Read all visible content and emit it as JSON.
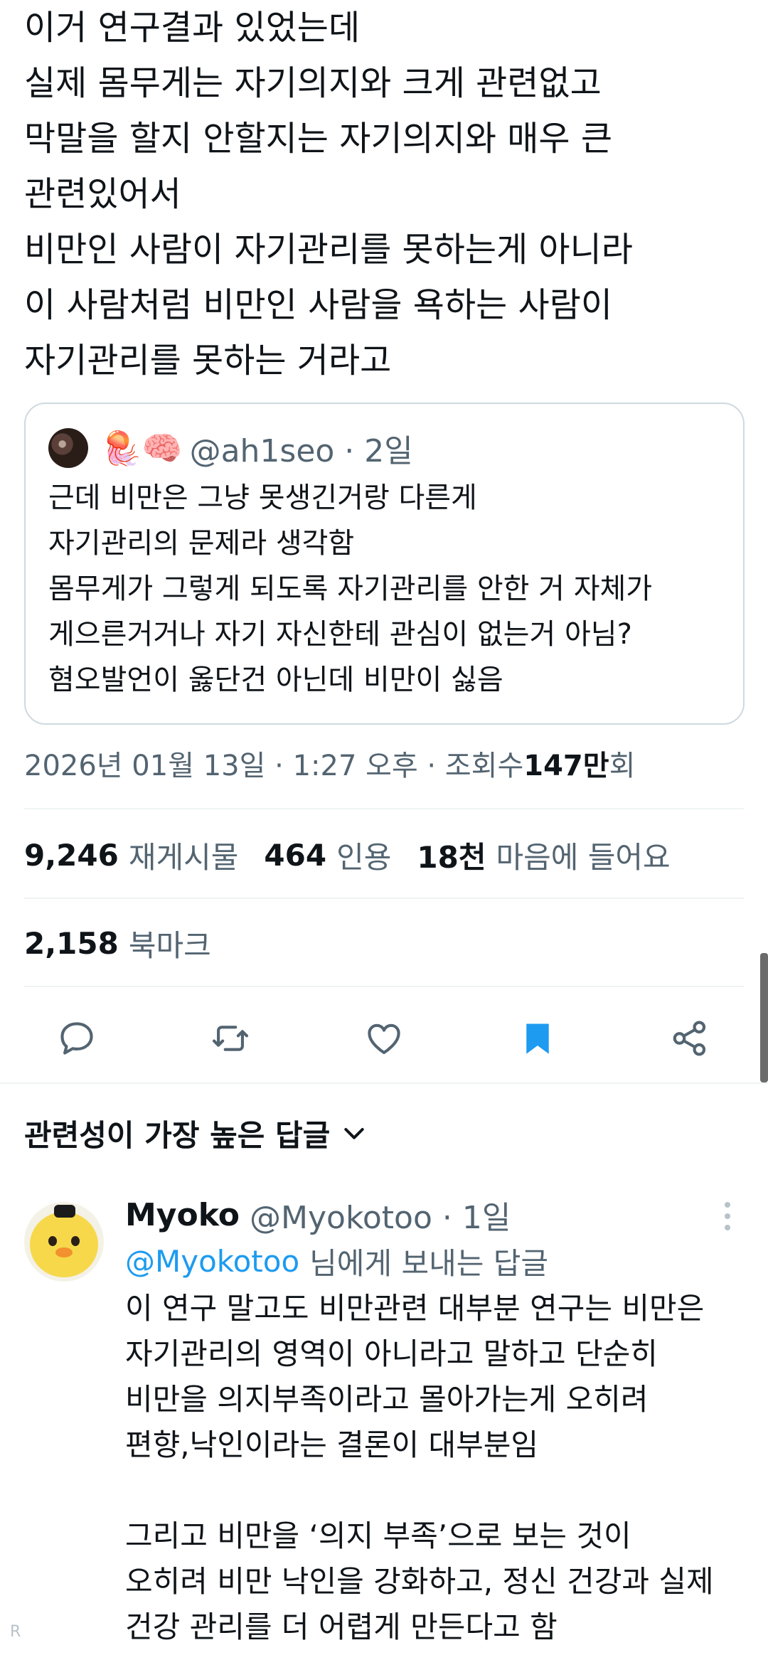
{
  "tweet": {
    "lines": [
      "이거 연구결과 있었는데",
      "실제 몸무게는 자기의지와 크게 관련없고",
      "막말을 할지 안할지는 자기의지와 매우 큰",
      "관련있어서",
      "비만인 사람이 자기관리를 못하는게 아니라",
      "이 사람처럼 비만인 사람을 욕하는 사람이",
      "자기관리를 못하는 거라고"
    ]
  },
  "quote": {
    "emojis": "🪼🧠",
    "handle": "@ah1seo · 2일",
    "lines": [
      "근데 비만은 그냥 못생긴거랑 다른게",
      "자기관리의 문제라 생각함",
      "몸무게가 그렇게 되도록 자기관리를 안한 거 자체가",
      "게으른거거나 자기 자신한테 관심이 없는거 아님?",
      "혐오발언이 옳단건 아닌데 비만이 싫음"
    ]
  },
  "meta": {
    "datetime": "2026년 01월 13일 · 1:27 오후 · 조회수 ",
    "views_num": "147만",
    "views_unit": "회"
  },
  "stats": {
    "retweets_num": "9,246",
    "retweets_label": "재게시물",
    "quotes_num": "464",
    "quotes_label": "인용",
    "likes_num": "18천",
    "likes_label": "마음에 들어요",
    "bookmarks_num": "2,158",
    "bookmarks_label": "북마크"
  },
  "colors": {
    "accent": "#1d9bf0",
    "icon": "#536471",
    "text": "#0f1419"
  },
  "replies_sort": {
    "label": "관련성이 가장 높은 답글"
  },
  "reply": {
    "name": "Myoko",
    "handle": "@Myokotoo · 1일",
    "mention": "@Myokotoo",
    "reply_to_suffix": "님에게 보내는 답글",
    "lines": [
      "이 연구 말고도 비만관련 대부분 연구는 비만은",
      "자기관리의 영역이 아니라고 말하고 단순히",
      "비만을 의지부족이라고 몰아가는게 오히려",
      "편향,낙인이라는 결론이 대부분임",
      "",
      "그리고 비만을 ‘의지 부족’으로 보는 것이",
      "오히려 비만 낙인을 강화하고, 정신 건강과 실제",
      "건강 관리를 더 어렵게 만든다고 함"
    ]
  },
  "footer": {
    "corner_mark": "R"
  }
}
